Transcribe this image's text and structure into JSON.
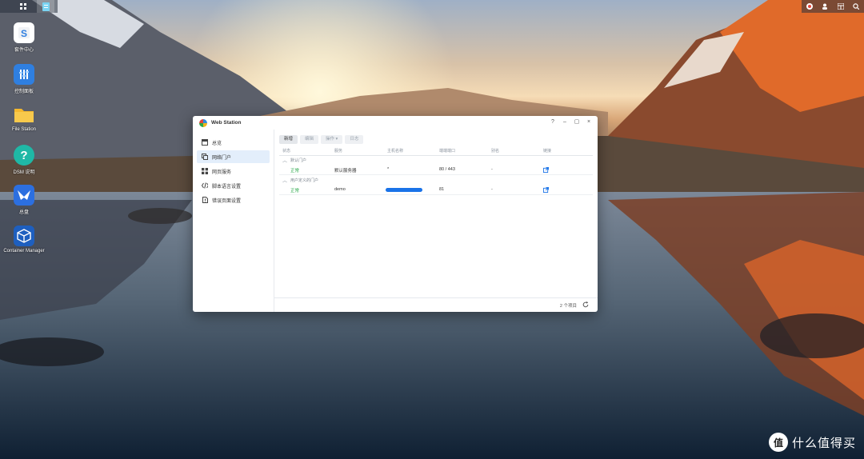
{
  "taskbar": {
    "left_icons": [
      "apps-grid-icon",
      "web-station-icon"
    ],
    "right_icons": [
      "chat-icon",
      "user-icon",
      "widgets-icon",
      "search-icon"
    ]
  },
  "desktop_icons": [
    {
      "label": "套件中心",
      "icon": "package-center-icon",
      "color": "#ffffff"
    },
    {
      "label": "控制面板",
      "icon": "control-panel-icon",
      "color": "#2f7fe0"
    },
    {
      "label": "File Station",
      "icon": "folder-icon",
      "color": "#f5b82e"
    },
    {
      "label": "DSM 说明",
      "icon": "help-icon",
      "color": "#1fb8a6"
    },
    {
      "label": "总盘",
      "icon": "bird-icon",
      "color": "#2c6fe0"
    },
    {
      "label": "Container Manager",
      "icon": "container-icon",
      "color": "#1e5fbf"
    }
  ],
  "window": {
    "title": "Web Station",
    "controls": [
      "?",
      "–",
      "▢",
      "×"
    ],
    "sidebar": [
      {
        "label": "总览",
        "icon": "overview-icon",
        "active": false
      },
      {
        "label": "网络门户",
        "icon": "portal-icon",
        "active": true
      },
      {
        "label": "网页服务",
        "icon": "web-service-icon",
        "active": false
      },
      {
        "label": "脚本语言设置",
        "icon": "code-icon",
        "active": false
      },
      {
        "label": "错误页面设置",
        "icon": "error-page-icon",
        "active": false
      }
    ],
    "toolbar": {
      "create": "新增",
      "edit": "编辑",
      "action": "操作 ▾",
      "log": "日志"
    },
    "columns": [
      "状态",
      "服务",
      "主机名称",
      "端端端口",
      "别名",
      "链接"
    ],
    "groups": [
      {
        "label": "默认门户",
        "rows": [
          {
            "status": "正常",
            "service": "默认服务器",
            "host": "*",
            "port": "80 / 443",
            "alias": "-"
          }
        ]
      },
      {
        "label": "用户定义的门户",
        "rows": [
          {
            "status": "正常",
            "service": "demo",
            "host": "",
            "port": "81",
            "alias": "-"
          }
        ]
      }
    ],
    "footer": {
      "count": "2 个项目"
    }
  },
  "watermark": {
    "text": "什么值得买"
  },
  "colors": {
    "accent": "#1a73e8",
    "status_ok": "#2aa84a"
  }
}
